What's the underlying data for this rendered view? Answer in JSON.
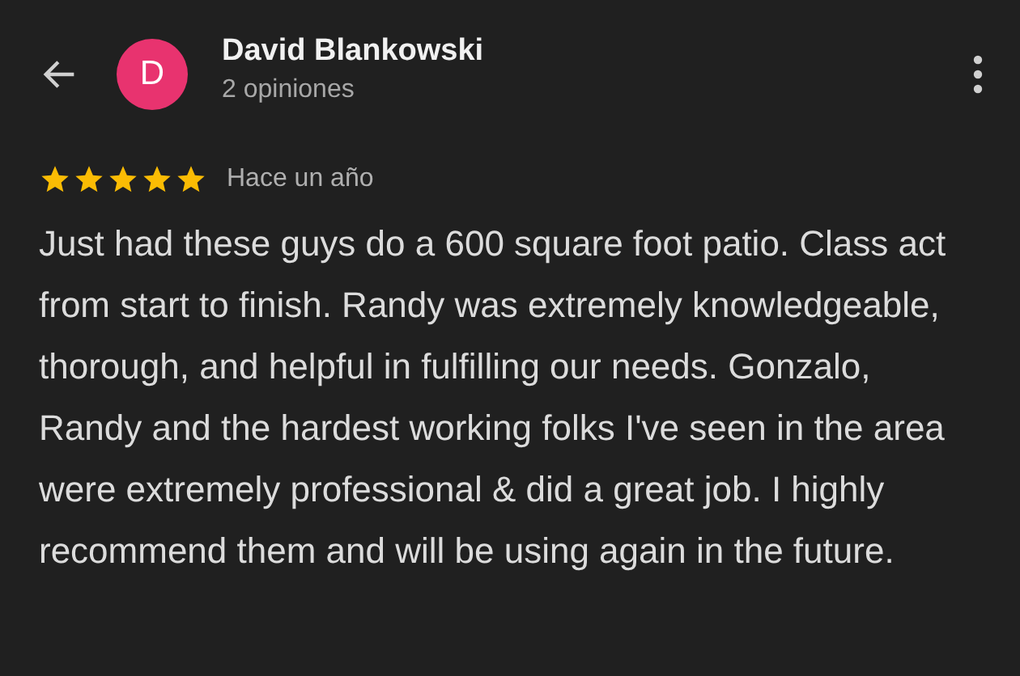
{
  "header": {
    "avatar_letter": "D",
    "name": "David Blankowski",
    "subtitle": "2 opiniones"
  },
  "review": {
    "stars": 5,
    "time": "Hace un año",
    "text": "Just had these guys do a 600 square foot patio. Class act from start to finish. Randy was extremely knowledgeable, thorough, and helpful in fulfilling our needs. Gonzalo, Randy and the hardest working folks I've seen in the area were extremely professional & did a great job. I highly recommend them and will be using again in the future."
  }
}
